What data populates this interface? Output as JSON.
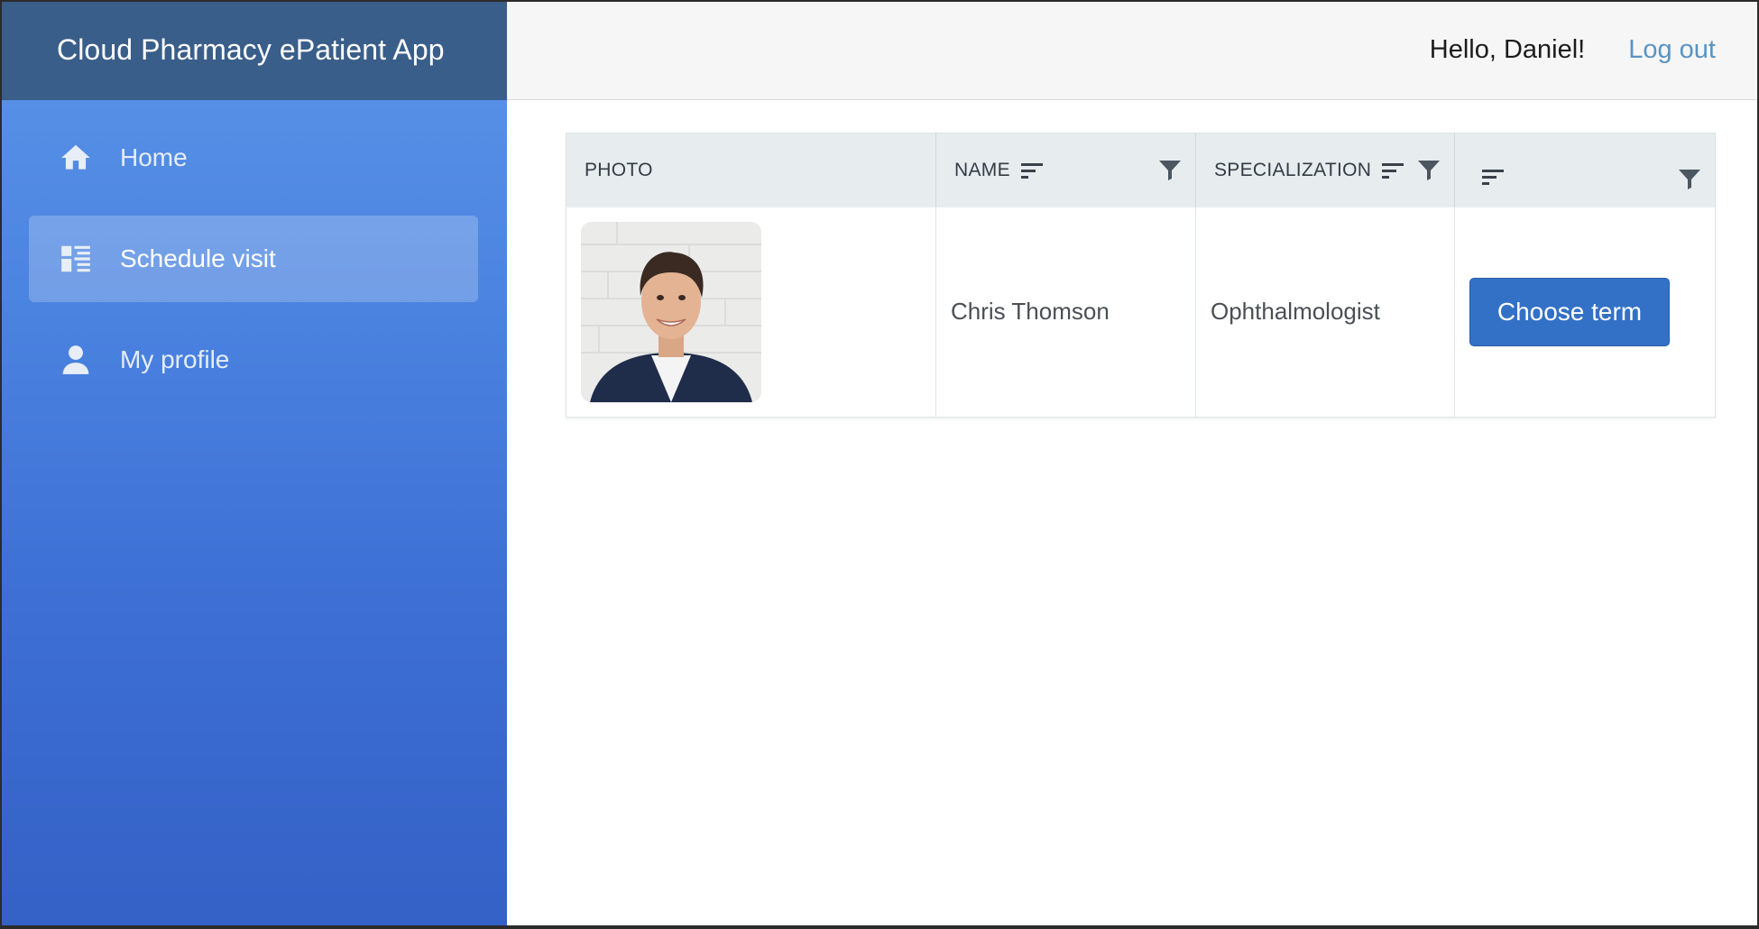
{
  "app": {
    "title": "Cloud Pharmacy ePatient App"
  },
  "sidebar": {
    "items": [
      {
        "label": "Home",
        "icon": "home-icon",
        "active": false
      },
      {
        "label": "Schedule visit",
        "icon": "schedule-list-icon",
        "active": true
      },
      {
        "label": "My profile",
        "icon": "user-icon",
        "active": false
      }
    ]
  },
  "header": {
    "greeting": "Hello, Daniel!",
    "logout_label": "Log out"
  },
  "table": {
    "columns": [
      {
        "label": "PHOTO",
        "sortable": false,
        "filterable": false
      },
      {
        "label": "NAME",
        "sortable": true,
        "filterable": true
      },
      {
        "label": "SPECIALIZATION",
        "sortable": true,
        "filterable": true
      },
      {
        "label": "",
        "sortable": true,
        "filterable": true
      }
    ],
    "rows": [
      {
        "photo": "doctor-portrait",
        "name": "Chris Thomson",
        "specialization": "Ophthalmologist",
        "action_label": "Choose term"
      }
    ]
  },
  "colors": {
    "brand_bar": "#3a5e8a",
    "sidebar_top": "#5b95e8",
    "sidebar_bottom": "#3461c6",
    "primary_button": "#3371c6",
    "link": "#5a93c2"
  }
}
